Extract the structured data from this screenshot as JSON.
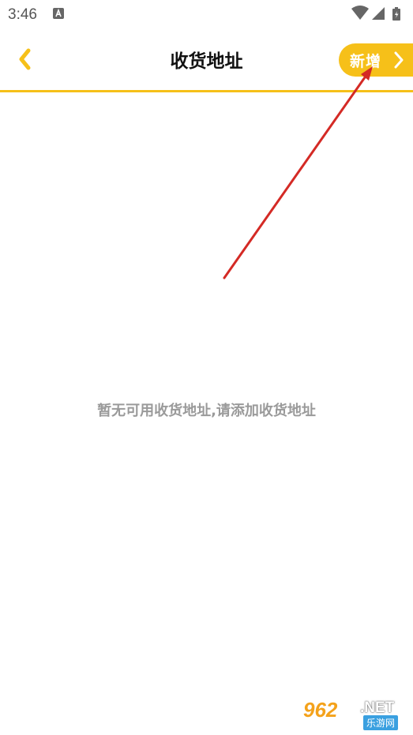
{
  "status_bar": {
    "time": "3:46",
    "left_icon": "a-notification-icon",
    "right_icons": [
      "wifi-icon",
      "signal-icon",
      "battery-icon"
    ]
  },
  "header": {
    "back_icon": "chevron-left-icon",
    "title": "收货地址",
    "add_button": {
      "label": "新增",
      "icon": "chevron-right-icon"
    }
  },
  "empty_state": {
    "message": "暂无可用收货地址,请添加收货地址"
  },
  "watermark": {
    "logo": "962",
    "net": ".NET",
    "sub": "乐游网"
  },
  "colors": {
    "accent": "#F6C019",
    "annotation_arrow": "#D42A25",
    "empty_text": "#9A9A9A",
    "title_text": "#111111"
  }
}
